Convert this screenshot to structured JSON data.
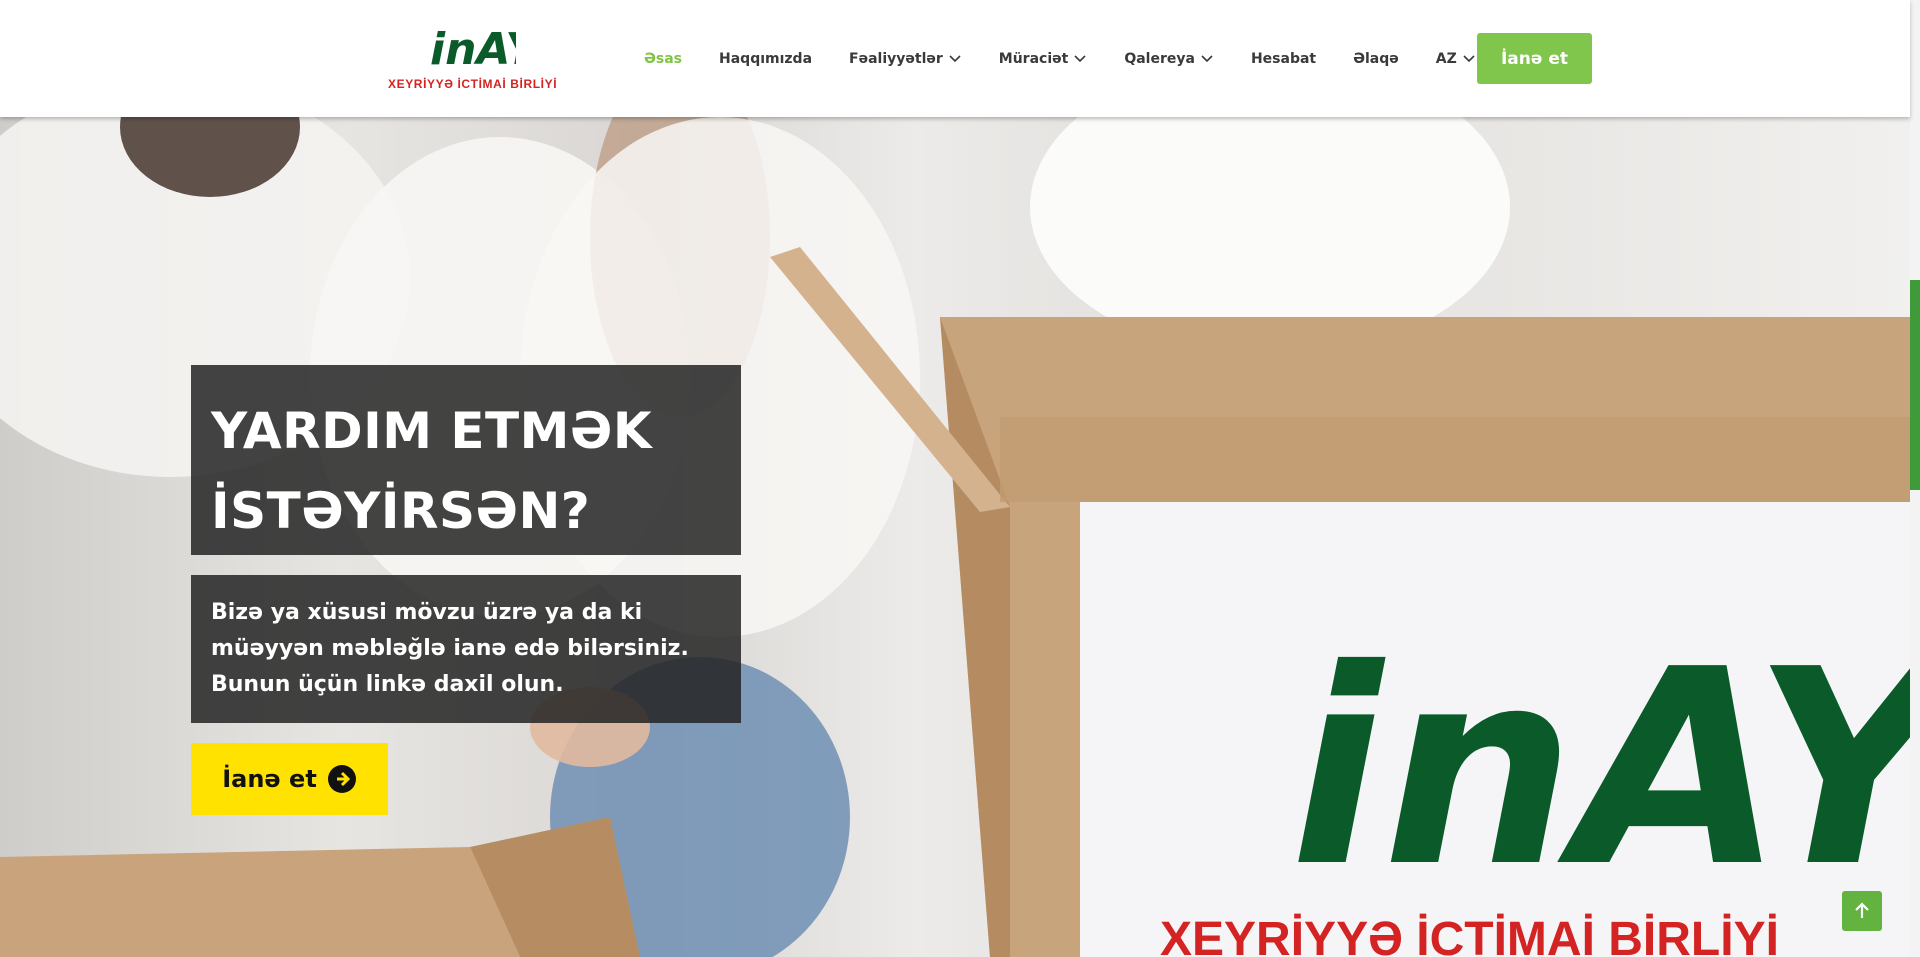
{
  "brand": {
    "logo_text": "inAYə",
    "subtitle": "XEYRİYYƏ İCTİMAİ BİRLİYİ",
    "colors": {
      "green": "#0a5a2a",
      "red": "#d42323",
      "accent": "#80c64c"
    }
  },
  "nav": {
    "items": [
      {
        "label": "Əsas",
        "active": true,
        "dropdown": false
      },
      {
        "label": "Haqqımızda",
        "active": false,
        "dropdown": false
      },
      {
        "label": "Fəaliyyətlər",
        "active": false,
        "dropdown": true
      },
      {
        "label": "Müraciət",
        "active": false,
        "dropdown": true
      },
      {
        "label": "Qalereya",
        "active": false,
        "dropdown": true
      },
      {
        "label": "Hesabat",
        "active": false,
        "dropdown": false
      },
      {
        "label": "Əlaqə",
        "active": false,
        "dropdown": false
      },
      {
        "label": "AZ",
        "active": false,
        "dropdown": true
      }
    ],
    "donate_label": "İanə et"
  },
  "hero": {
    "headline_line1": "YARDIM ETMƏK",
    "headline_line2": "İSTƏYİRSƏN?",
    "sub_line1": "Bizə ya xüsusi mövzu üzrə ya da ki",
    "sub_line2": "müəyyən məbləğlə ianə edə bilərsiniz.",
    "sub_line3": "Bunun üçün linkə daxil olun.",
    "cta_label": "İanə et",
    "cta_icon": "arrow-circle-right-icon",
    "box_logo_text": "inAYə",
    "box_subtitle": "XEYRİYYƏ İCTİMAİ BİRLİYİ"
  },
  "scroll_top_icon": "arrow-up-icon"
}
